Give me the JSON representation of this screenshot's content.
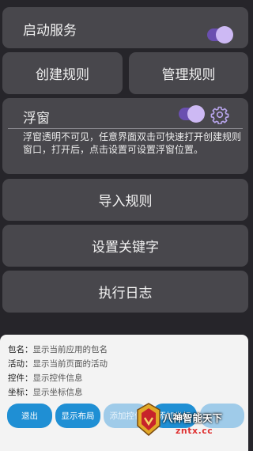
{
  "start_service": {
    "label": "启动服务",
    "enabled": true
  },
  "create_rule": {
    "label": "创建规则"
  },
  "manage_rule": {
    "label": "管理规则"
  },
  "floating_window": {
    "label": "浮窗",
    "enabled": true,
    "settings_icon": "gear-icon",
    "description": "浮窗透明不可见，任意界面双击可快速打开创建规则窗口，打开后，点击设置可设置浮窗位置。"
  },
  "import_rule": {
    "label": "导入规则"
  },
  "set_keywords": {
    "label": "设置关键字"
  },
  "execution_log": {
    "label": "执行日志"
  },
  "inspector_panel": {
    "lines": [
      {
        "key": "包名",
        "sep": "：",
        "value": "显示当前应用的包名"
      },
      {
        "key": "活动",
        "sep": "：",
        "value": "显示当前页面的活动"
      },
      {
        "key": "控件",
        "sep": "：",
        "value": "显示控件信息"
      },
      {
        "key": "坐标",
        "sep": "：",
        "value": "显示坐标信息"
      }
    ],
    "buttons": {
      "exit": "退出",
      "show_layout": "显示布局",
      "add_control": "添加控件",
      "add_coordinate": "添加坐标",
      "extra": ""
    }
  },
  "watermark": {
    "text": "八神智能天下",
    "url": "zntx.cc"
  },
  "colors": {
    "background": "#26252a",
    "card": "#48474c",
    "toggle_track": "#6a4fb0",
    "toggle_knob": "#cdb9f4",
    "button_primary": "#1f8fd4",
    "button_disabled": "#9fcbe9"
  }
}
